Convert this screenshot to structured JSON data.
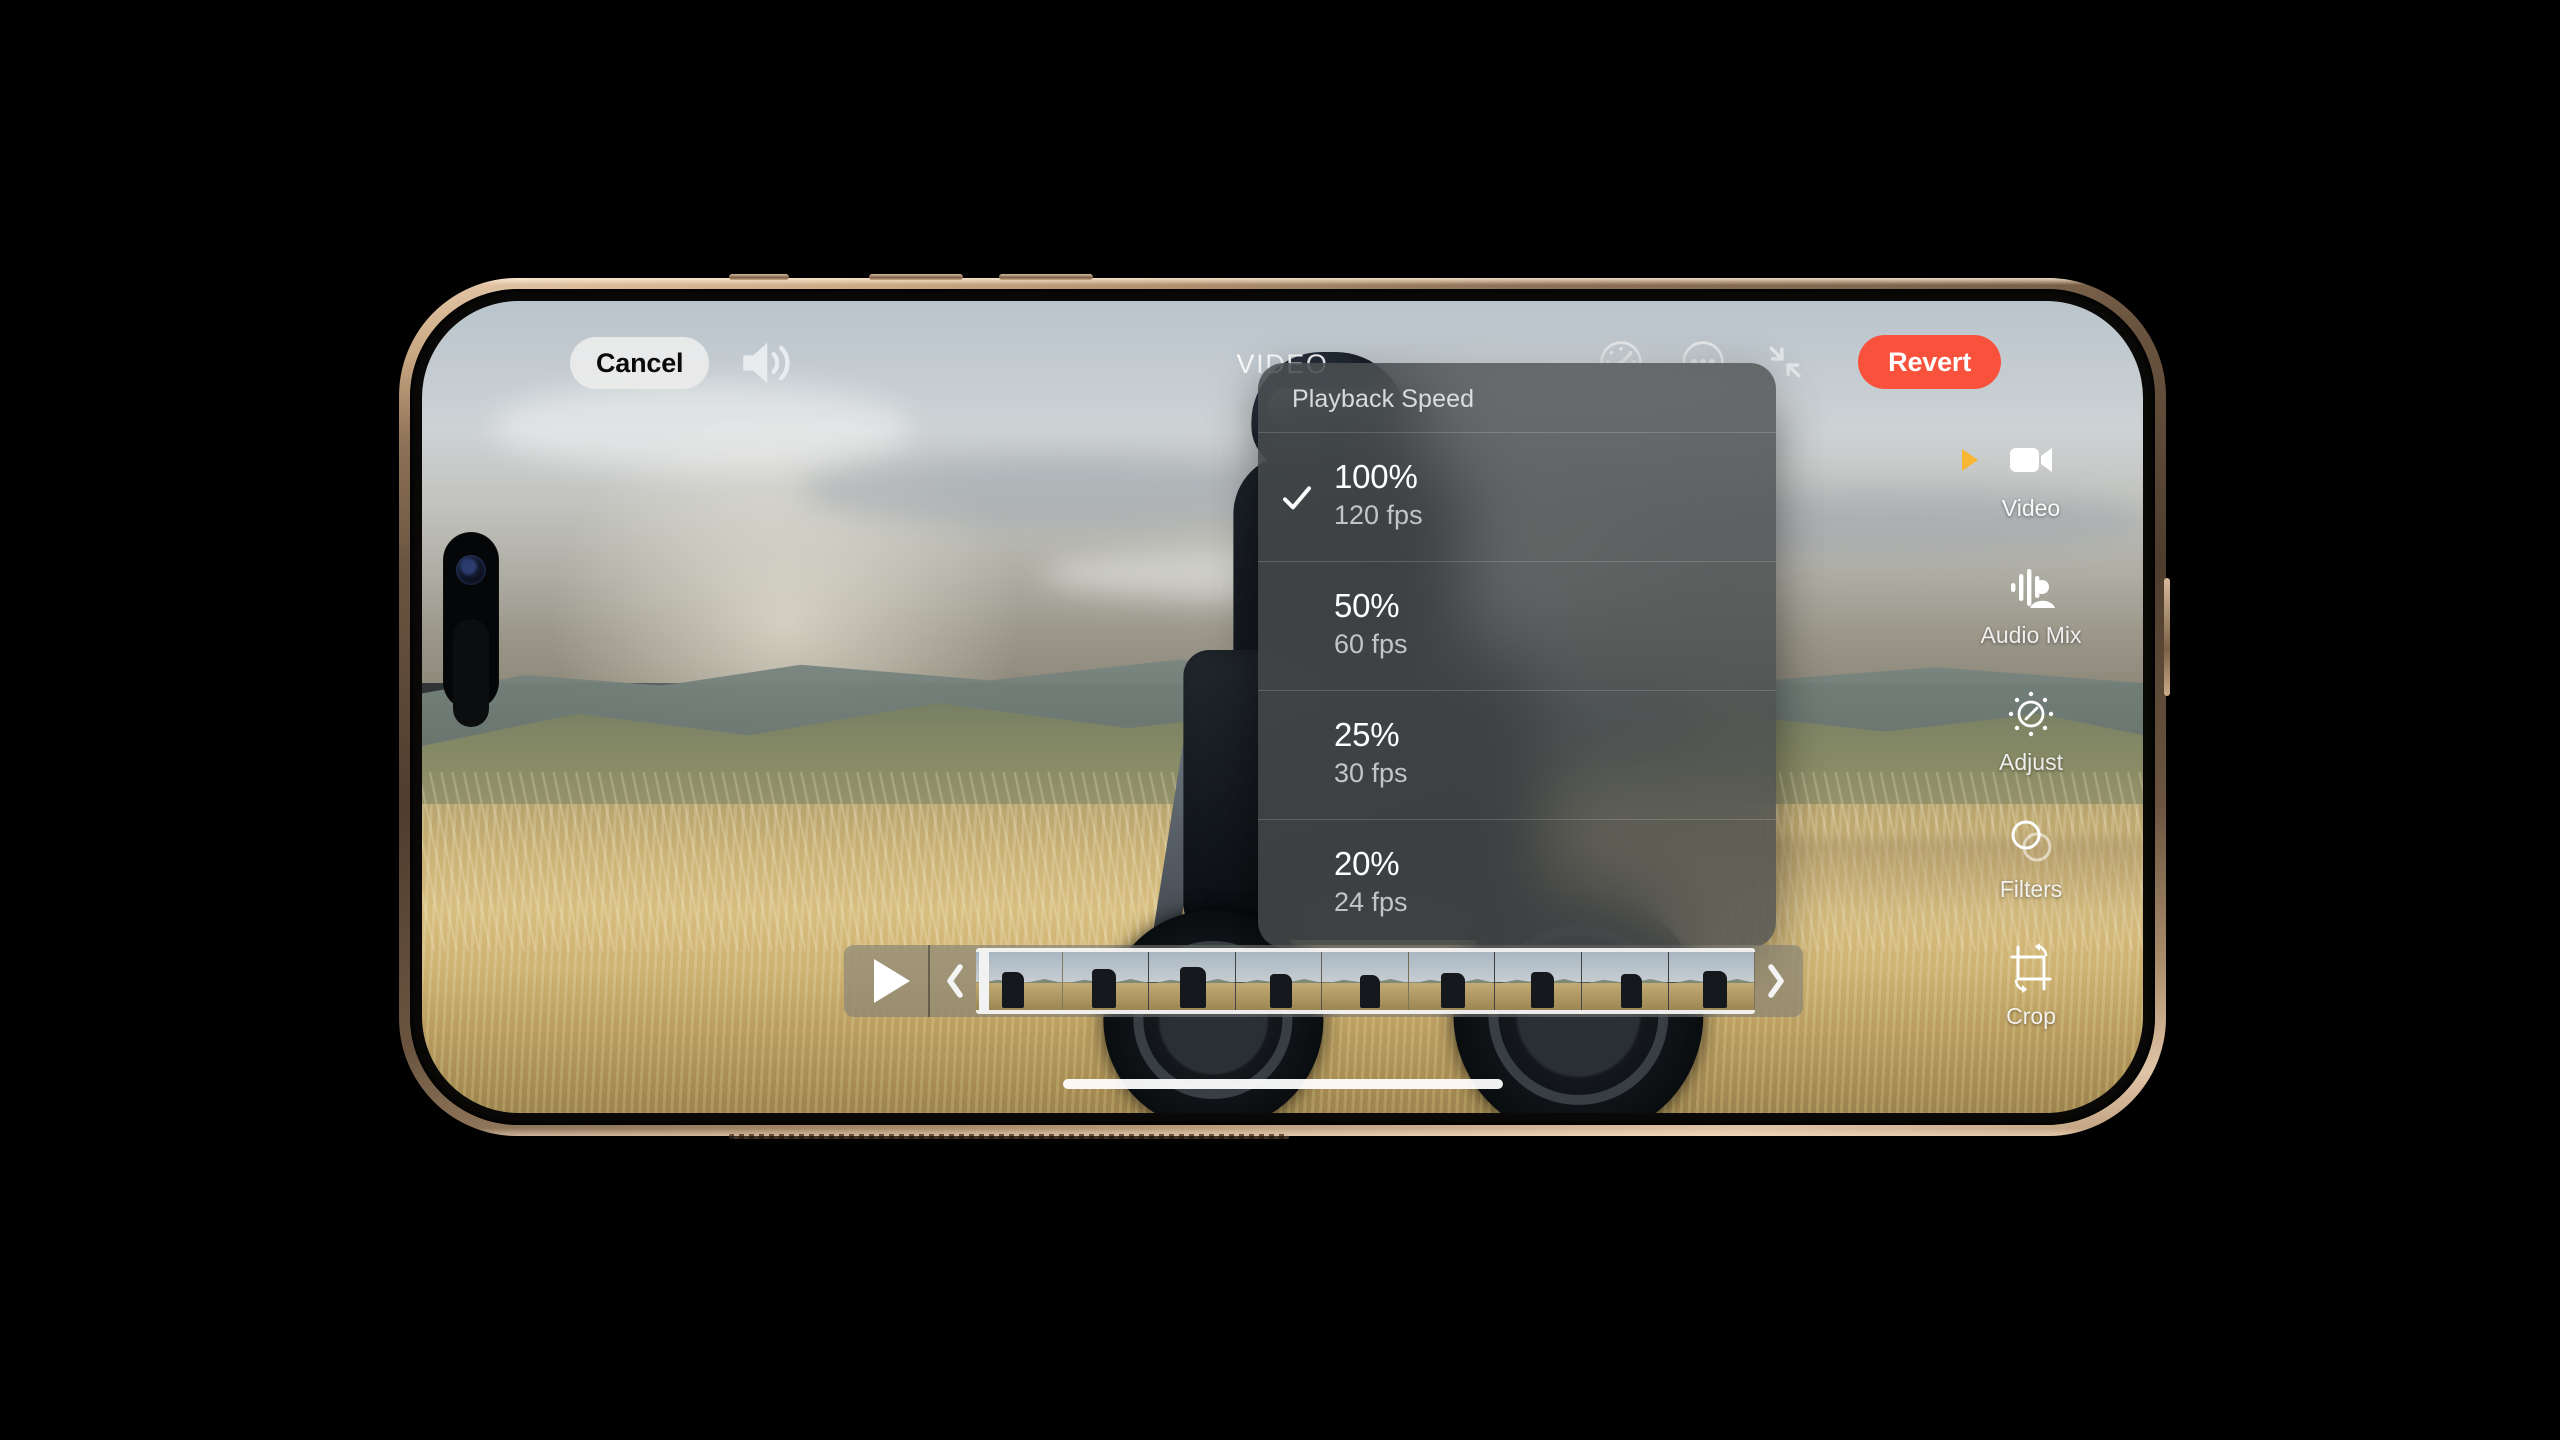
{
  "app": {
    "screen_title": "VIDEO"
  },
  "topbar": {
    "cancel_label": "Cancel",
    "revert_label": "Revert",
    "icons": {
      "volume": "speaker-wave-icon",
      "speed": "speedometer-icon",
      "more": "more-options-icon",
      "collapse": "collapse-arrows-icon"
    }
  },
  "speed_menu": {
    "header": "Playback Speed",
    "options": [
      {
        "percent": "100%",
        "fps": "120 fps",
        "selected": true
      },
      {
        "percent": "50%",
        "fps": "60 fps",
        "selected": false
      },
      {
        "percent": "25%",
        "fps": "30 fps",
        "selected": false
      },
      {
        "percent": "20%",
        "fps": "24 fps",
        "selected": false
      }
    ]
  },
  "tool_rail": {
    "items": [
      {
        "label": "Video",
        "icon": "video-camera-icon",
        "active": true
      },
      {
        "label": "Audio Mix",
        "icon": "audio-mix-icon",
        "active": false
      },
      {
        "label": "Adjust",
        "icon": "adjust-dial-icon",
        "active": false
      },
      {
        "label": "Filters",
        "icon": "filters-circles-icon",
        "active": false
      },
      {
        "label": "Crop",
        "icon": "crop-rotate-icon",
        "active": false
      }
    ]
  },
  "timeline": {
    "play_icon": "play-triangle-icon",
    "trim_start_icon": "chevron-left-icon",
    "trim_end_icon": "chevron-right-icon",
    "frame_count": 9
  },
  "colors": {
    "accent_revert": "#f8523c",
    "active_marker": "#f7b733",
    "menu_background": "rgba(72,76,77,0.80)",
    "cancel_background": "rgba(235,235,235,0.92)",
    "device_band": "#c9a883"
  }
}
